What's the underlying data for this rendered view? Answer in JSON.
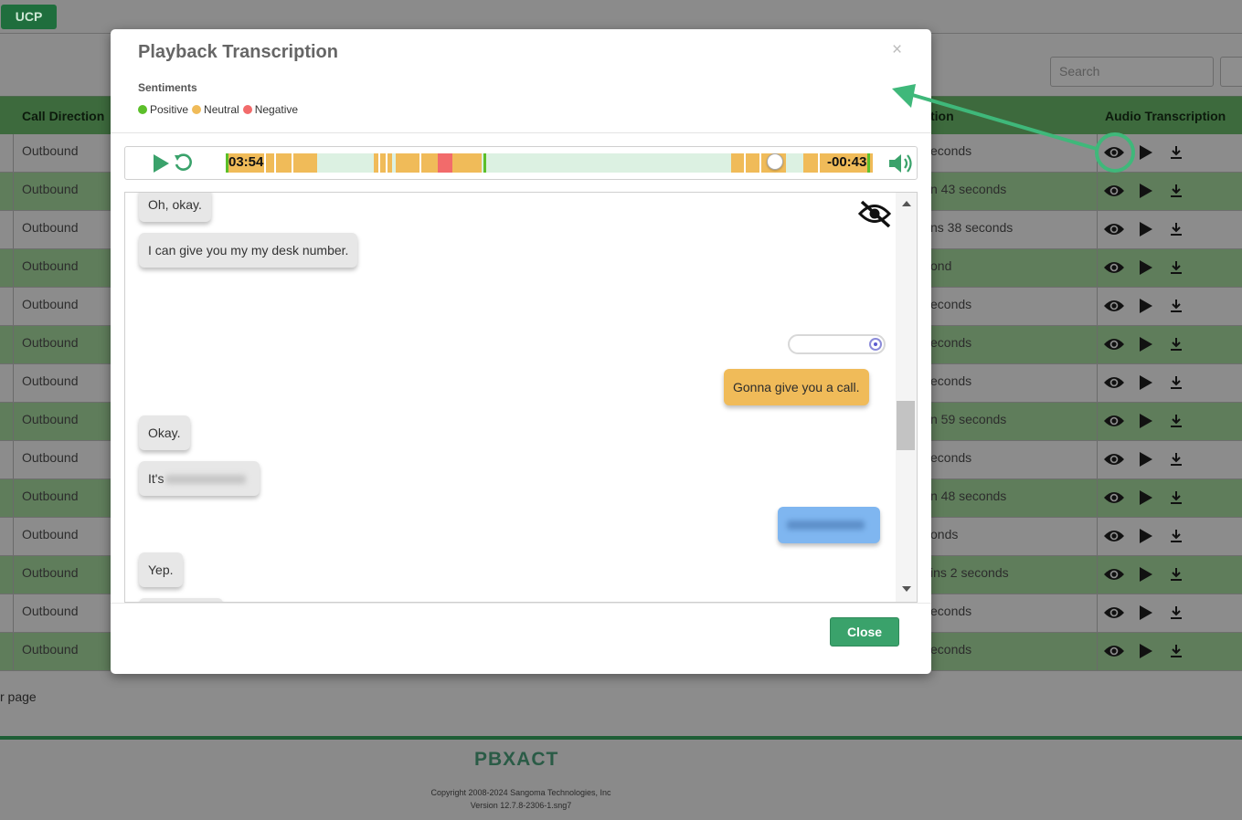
{
  "app": {
    "ucp_label": "UCP",
    "search_placeholder": "Search"
  },
  "table": {
    "headers": {
      "call_direction": "Call Direction",
      "duration_partial": "tion",
      "audio_transcription": "Audio Transcription"
    },
    "rows": [
      {
        "direction": "Outbound",
        "duration": "econds"
      },
      {
        "direction": "Outbound",
        "duration": "n 43 seconds"
      },
      {
        "direction": "Outbound",
        "duration": "ns 38 seconds"
      },
      {
        "direction": "Outbound",
        "duration": "ond"
      },
      {
        "direction": "Outbound",
        "duration": "econds"
      },
      {
        "direction": "Outbound",
        "duration": "econds"
      },
      {
        "direction": "Outbound",
        "duration": "econds"
      },
      {
        "direction": "Outbound",
        "duration": "n 59 seconds"
      },
      {
        "direction": "Outbound",
        "duration": "econds"
      },
      {
        "direction": "Outbound",
        "duration": "n 48 seconds"
      },
      {
        "direction": "Outbound",
        "duration": "onds"
      },
      {
        "direction": "Outbound",
        "duration": "ins 2 seconds"
      },
      {
        "direction": "Outbound",
        "duration": "econds"
      },
      {
        "direction": "Outbound",
        "duration": "econds"
      }
    ]
  },
  "page_footer": {
    "per_page_text": "r page",
    "logo": "PBXACT",
    "copyright": "Copyright 2008-2024 Sangoma Technologies, Inc",
    "version": "Version 12.7.8-2306-1.sng7"
  },
  "modal": {
    "title": "Playback Transcription",
    "close_x": "×",
    "sentiments_label": "Sentiments",
    "legend": [
      {
        "label": "Positive",
        "color": "#5cbf2a"
      },
      {
        "label": "Neutral",
        "color": "#f0bb59"
      },
      {
        "label": "Negative",
        "color": "#f26b6b"
      }
    ],
    "player": {
      "current_time": "03:54",
      "remaining_time": "-00:43",
      "progress_fraction": 0.84
    },
    "transcript": [
      {
        "speaker": "agent",
        "text": "Oh, okay."
      },
      {
        "speaker": "agent",
        "text": "I can give you my my desk number."
      },
      {
        "speaker": "caller",
        "text": "Gonna give you a call."
      },
      {
        "speaker": "agent",
        "text": "Okay."
      },
      {
        "speaker": "agent",
        "text": "It's"
      },
      {
        "speaker": "agent",
        "text": "Yep."
      }
    ],
    "close_button": "Close"
  }
}
